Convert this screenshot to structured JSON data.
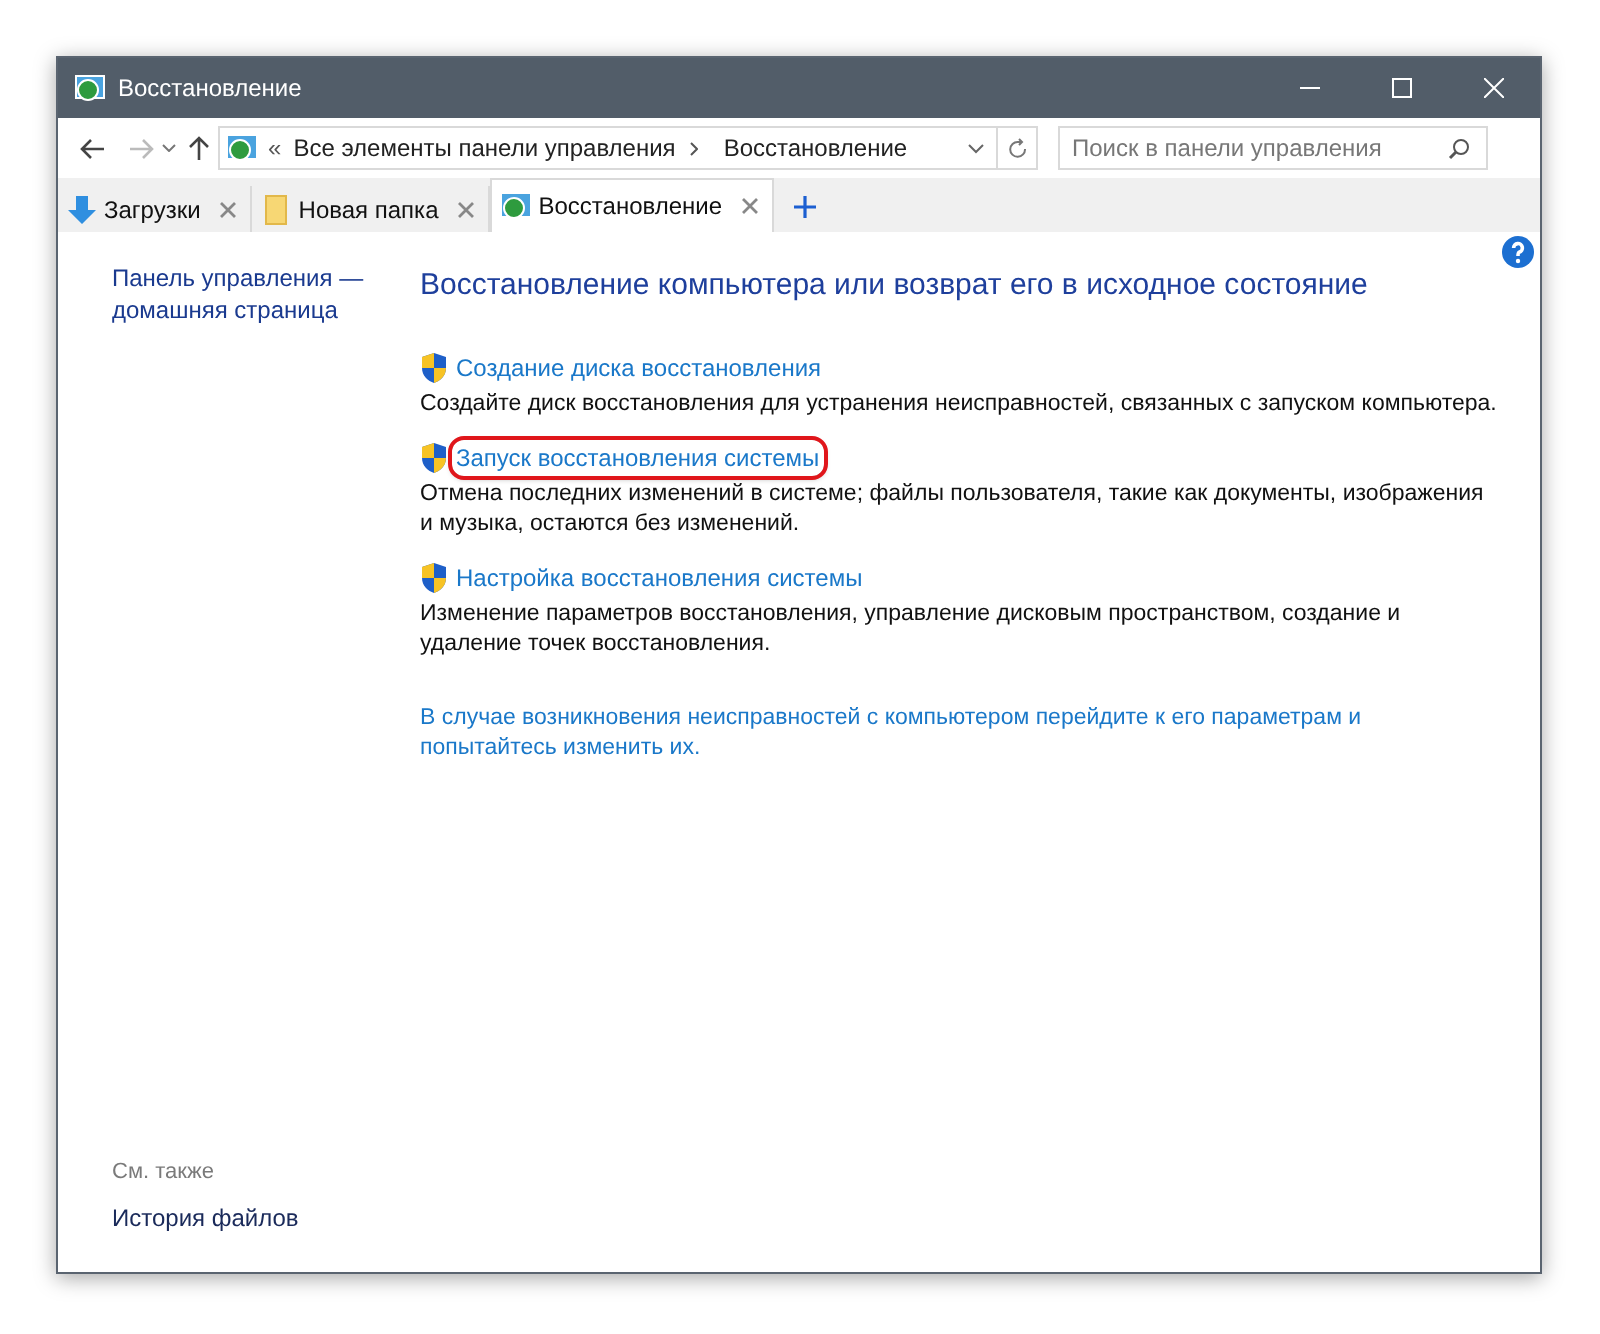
{
  "window": {
    "title": "Восстановление"
  },
  "address_bar": {
    "prefix": "«",
    "path": [
      {
        "label": "Все элементы панели управления"
      },
      {
        "label": "Восстановление"
      }
    ]
  },
  "search": {
    "placeholder": "Поиск в панели управления"
  },
  "tabs": [
    {
      "label": "Загрузки",
      "kind": "download",
      "selected": false
    },
    {
      "label": "Новая папка",
      "kind": "folder",
      "selected": false
    },
    {
      "label": "Восстановление",
      "kind": "recovery",
      "selected": true
    }
  ],
  "sidebar": {
    "home_link": "Панель управления — домашняя страница",
    "see_also_title": "См. также",
    "see_also": [
      {
        "label": "История файлов"
      }
    ]
  },
  "content": {
    "heading": "Восстановление компьютера или возврат его в исходное состояние",
    "items": [
      {
        "link": "Создание диска восстановления",
        "description": "Создайте диск восстановления для устранения неисправностей, связанных с запуском компьютера.",
        "highlighted": false
      },
      {
        "link": "Запуск восстановления системы",
        "description": "Отмена последних изменений в системе; файлы пользователя, такие как документы, изображения и музыка, остаются без изменений.",
        "highlighted": true
      },
      {
        "link": "Настройка восстановления системы",
        "description": "Изменение параметров восстановления, управление дисковым пространством, создание и удаление точек восстановления.",
        "highlighted": false
      }
    ],
    "footer_link": "В случае возникновения неисправностей с компьютером перейдите к его параметрам и попытайтесь изменить их."
  }
}
